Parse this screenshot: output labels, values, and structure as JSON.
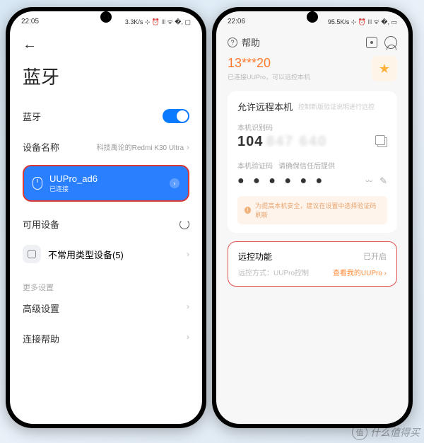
{
  "left": {
    "status": {
      "time": "22:05",
      "right": "3.3K/s ⊹ ⏰ ꔖ ᯤ �, ▢"
    },
    "title": "蓝牙",
    "bluetooth_label": "蓝牙",
    "device_name_label": "设备名称",
    "device_name_value": "科技禹论的Redmi K30 Ultra",
    "connected": {
      "name": "UUPro_ad6",
      "status": "已连接"
    },
    "available_label": "可用设备",
    "uncommon_label": "不常用类型设备(5)",
    "more_label": "更多设置",
    "advanced_label": "高级设置",
    "help_label": "连接帮助"
  },
  "right": {
    "status": {
      "time": "22:06",
      "right": "95.5K/s ⊹ ⏰ ꔖ ᯤ �, ▭"
    },
    "help_title": "帮助",
    "phone_masked": "13***20",
    "account_sub": "已连接UUPro，可以远控本机",
    "card_title": "允许远程本机",
    "card_sub": "控制新版验证说明进行远控",
    "id_label": "本机识别码",
    "id_value": "104",
    "verify_label": "本机验证码",
    "verify_hint": "请确保信任后提供",
    "dots": "● ● ● ● ● ●",
    "warning": "为提高本机安全，建议在设置中选择验证码刷新",
    "remote": {
      "title": "远控功能",
      "status": "已开启",
      "method_label": "远控方式：UUPro控制",
      "link": "查看我的UUPro ›"
    }
  },
  "watermark": "什么值得买"
}
